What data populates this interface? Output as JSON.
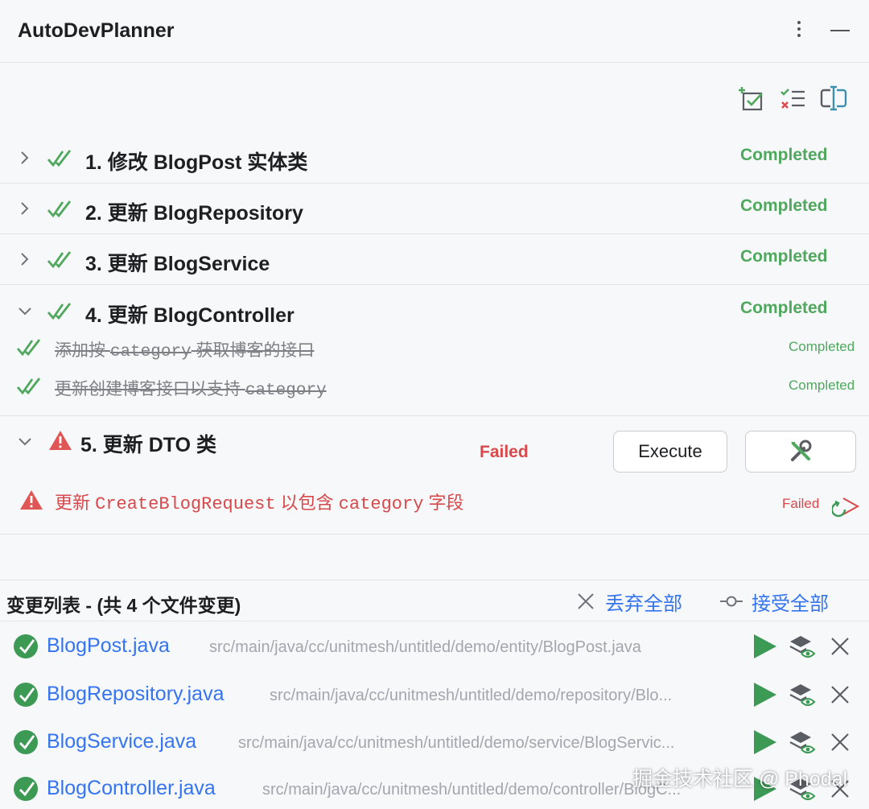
{
  "window": {
    "title": "AutoDevPlanner",
    "actions": [
      "more-icon",
      "minimize-icon"
    ]
  },
  "toolbar": {
    "icons": [
      "add-task-icon",
      "checklist-icon",
      "edit-plan-icon"
    ]
  },
  "plan": {
    "steps": [
      {
        "title": "1. 修改 BlogPost 实体类",
        "status": "Completed",
        "expanded": false
      },
      {
        "title": "2. 更新 BlogRepository",
        "status": "Completed",
        "expanded": false
      },
      {
        "title": "3. 更新 BlogService",
        "status": "Completed",
        "expanded": false
      },
      {
        "title": "4. 更新 BlogController",
        "status": "Completed",
        "expanded": true,
        "subtasks": [
          {
            "prefix": "添加按 ",
            "code": "category",
            "suffix": " 获取博客的接口",
            "status": "Completed"
          },
          {
            "prefix": "更新创建博客接口以支持 ",
            "code": "category",
            "suffix": "",
            "status": "Completed"
          }
        ]
      },
      {
        "title": "5. 更新 DTO 类",
        "status": "Failed",
        "expanded": true,
        "execute_label": "Execute",
        "subtasks": [
          {
            "prefix": "更新 ",
            "code": "CreateBlogRequest",
            "middle": " 以包含 ",
            "code2": "category",
            "suffix": " 字段",
            "status": "Failed"
          }
        ]
      }
    ]
  },
  "changes": {
    "title": "变更列表 - (共 4 个文件变更)",
    "discard_label": "丢弃全部",
    "accept_label": "接受全部",
    "files": [
      {
        "name": "BlogPost.java",
        "path": "src/main/java/cc/unitmesh/untitled/demo/entity/BlogPost.java"
      },
      {
        "name": "BlogRepository.java",
        "path": "src/main/java/cc/unitmesh/untitled/demo/repository/Blo..."
      },
      {
        "name": "BlogService.java",
        "path": "src/main/java/cc/unitmesh/untitled/demo/service/BlogServic..."
      },
      {
        "name": "BlogController.java",
        "path": "src/main/java/cc/unitmesh/untitled/demo/controller/BlogC..."
      }
    ]
  },
  "watermark": "掘金技术社区 @ Phodal",
  "colors": {
    "success": "#4fa85d",
    "error": "#d9484a",
    "link": "#3574f0",
    "run": "#3d9a55"
  }
}
